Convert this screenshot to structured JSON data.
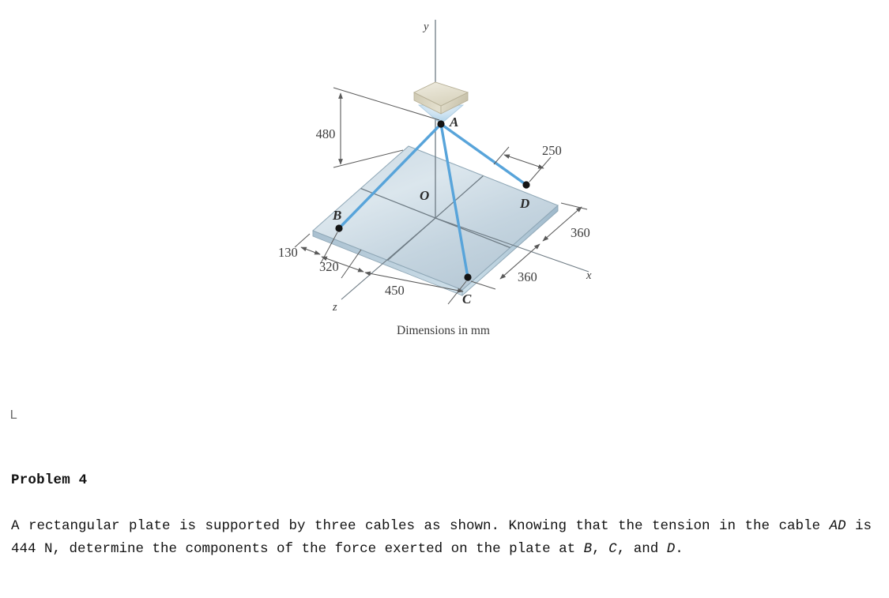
{
  "figure": {
    "caption": "Dimensions in mm",
    "axes": {
      "y": "y",
      "x": "x",
      "z": "z"
    },
    "points": {
      "a": "A",
      "b": "B",
      "c": "C",
      "d": "D",
      "o": "O"
    },
    "dimensions": {
      "height_480": "480",
      "d_250": "250",
      "d_130": "130",
      "d_320": "320",
      "d_450": "450",
      "d_360_upper": "360",
      "d_360_lower": "360"
    },
    "colors": {
      "cable": "#58a4da",
      "plate_fill_light": "#dde7ee",
      "plate_fill_dark": "#bcccd8",
      "plate_edge": "#8fa7b6",
      "anchor_block": "#ddd8c4",
      "dimension_line": "#5a5a5a"
    }
  },
  "stray_glyph": "L",
  "problem": {
    "heading": "Problem 4",
    "body_line1": "A  rectangular  plate  is  supported  by  three  cables  as  shown.  Knowing",
    "body_line2_pre": "that the tension in the cable ",
    "body_line2_em": "AD",
    "body_line2_post": " is 444 N, determine the components of",
    "body_line3_pre": "the force exerted on the plate at ",
    "body_line3_b": "B",
    "body_line3_mid1": ", ",
    "body_line3_c": "C",
    "body_line3_mid2": ", and ",
    "body_line3_d": "D",
    "body_line3_end": ".",
    "tension_value": "444 N",
    "cable_label": "AD"
  }
}
